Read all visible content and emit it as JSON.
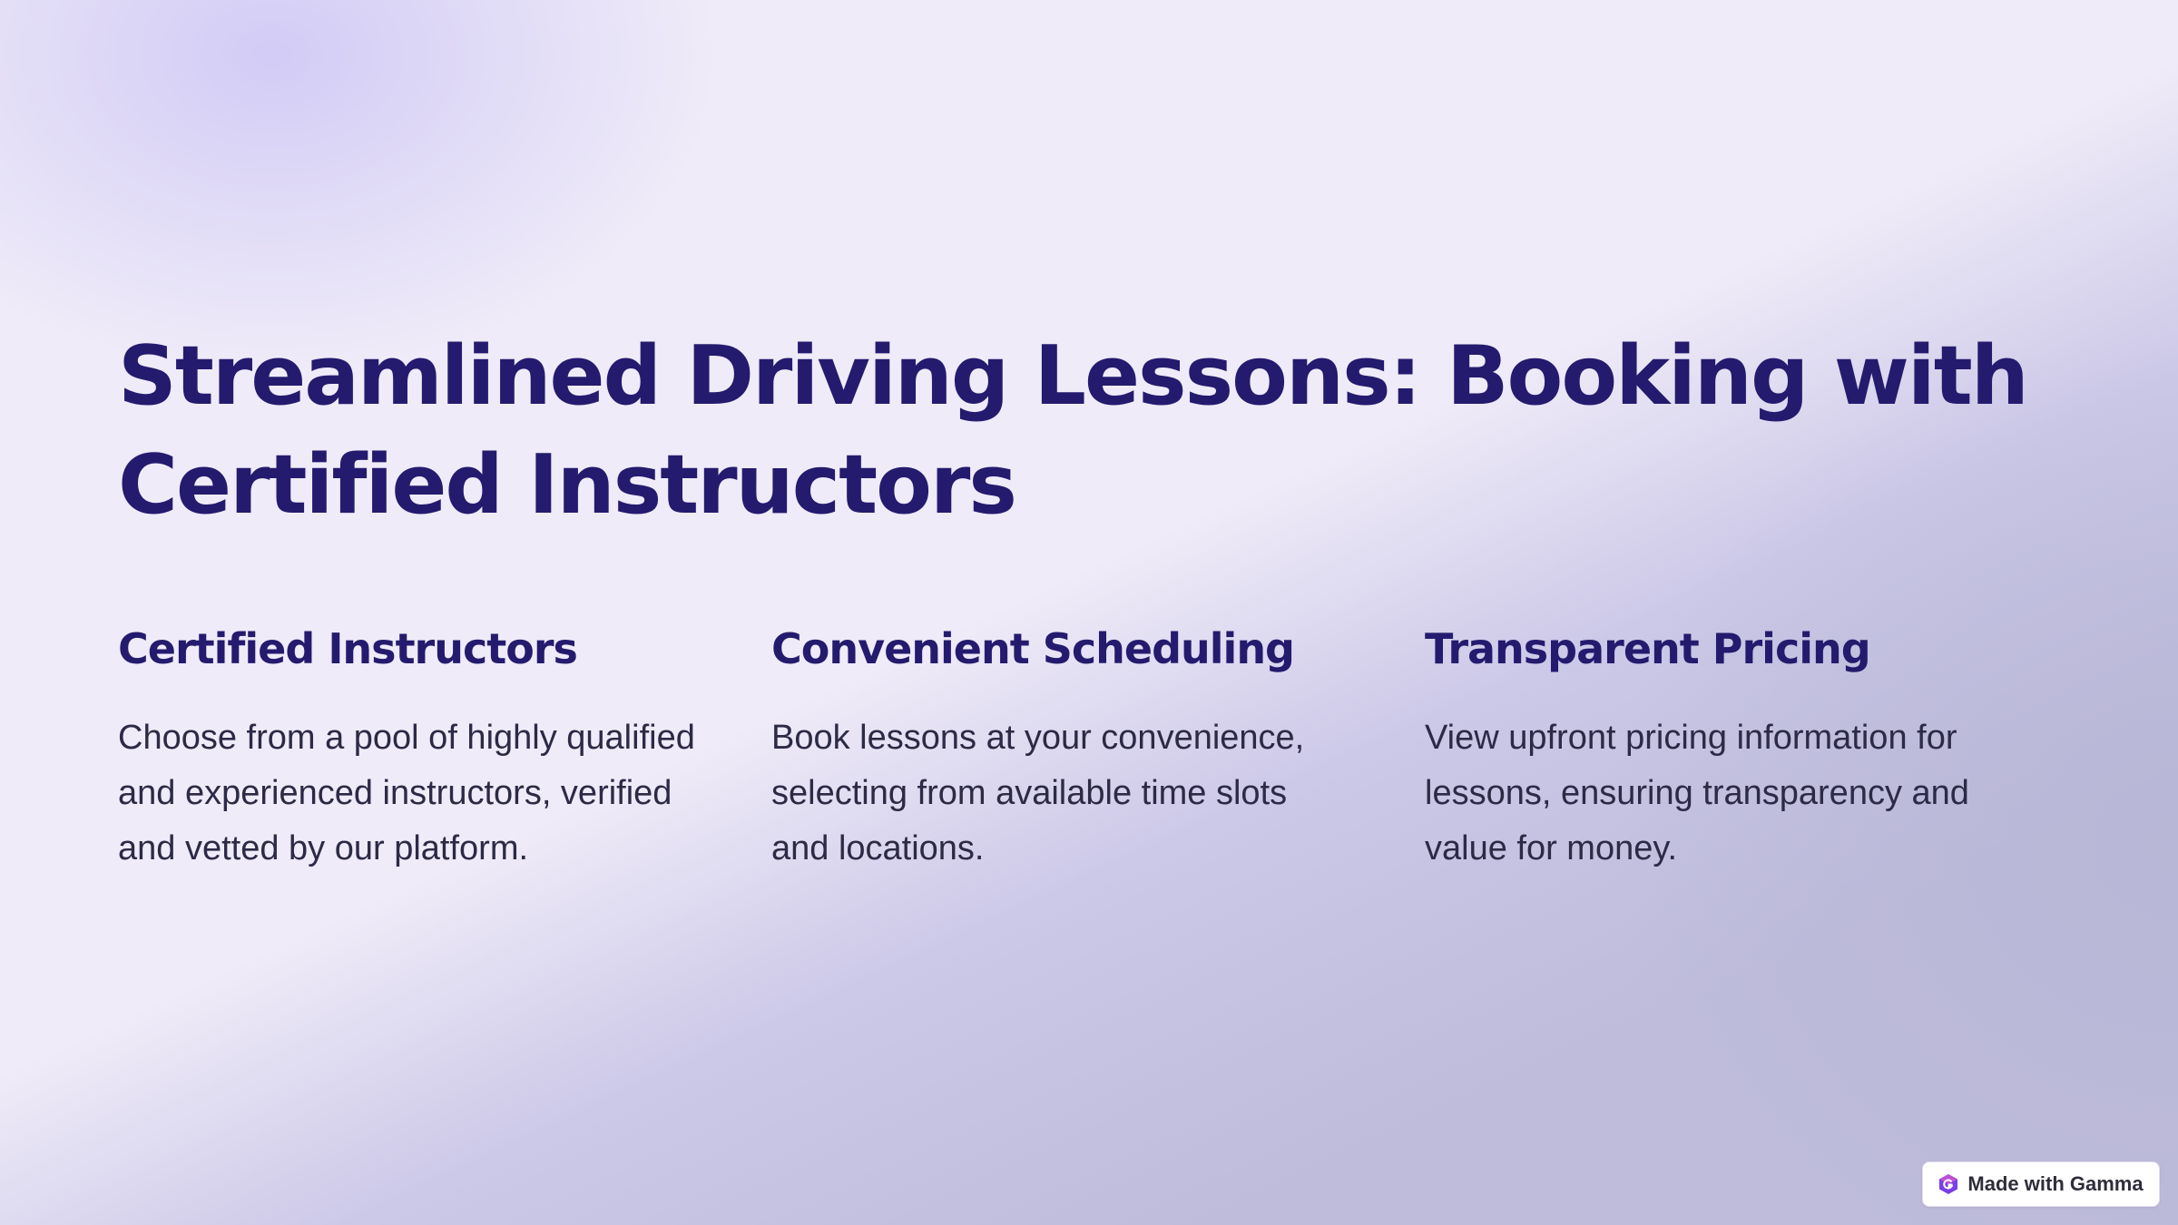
{
  "slide": {
    "title": "Streamlined Driving Lessons: Booking with Certified Instructors",
    "columns": [
      {
        "heading": "Certified Instructors",
        "body": "Choose from a pool of highly qualified and experienced instructors, verified and vetted by our platform."
      },
      {
        "heading": "Convenient Scheduling",
        "body": "Book lessons at your convenience, selecting from available time slots and locations."
      },
      {
        "heading": "Transparent Pricing",
        "body": "View upfront pricing information for lessons, ensuring transparency and value for money."
      }
    ]
  },
  "badge": {
    "label": "Made with Gamma",
    "icon": "gamma-logo-icon"
  },
  "colors": {
    "heading": "#241b6e",
    "body_text": "#2c2a45",
    "background": "#efebf8",
    "accent_gradient": "#bcbad8"
  }
}
